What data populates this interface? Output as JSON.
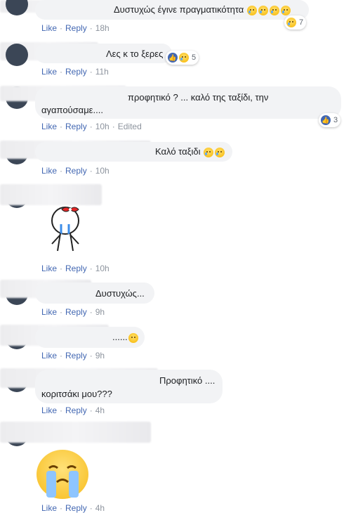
{
  "actions": {
    "like": "Like",
    "reply": "Reply",
    "edited": "Edited"
  },
  "comments": [
    {
      "text": "Δυστυχώς έγινε πραγματικότητα",
      "time": "18h",
      "reaction_count": "7"
    },
    {
      "text": "Λες κ το ξερες",
      "time": "11h",
      "reaction_count": "5"
    },
    {
      "text_line1": "προφητικό ? ... καλό της ταξίδι, την",
      "text_line2": "αγαπούσαμε....",
      "time": "10h",
      "reaction_count": "3"
    },
    {
      "text": "Καλό ταξιδι",
      "time": "10h"
    },
    {
      "sticker": "crying-stick-figure-with-bow",
      "time": "10h"
    },
    {
      "text": "Δυστυχώς...",
      "time": "9h"
    },
    {
      "text": "......",
      "time": "9h"
    },
    {
      "text_line1": "Προφητικό ....",
      "text_line2": "κοριτσάκι μου???",
      "time": "4h"
    },
    {
      "sticker": "crying-face",
      "time": "4h"
    }
  ]
}
